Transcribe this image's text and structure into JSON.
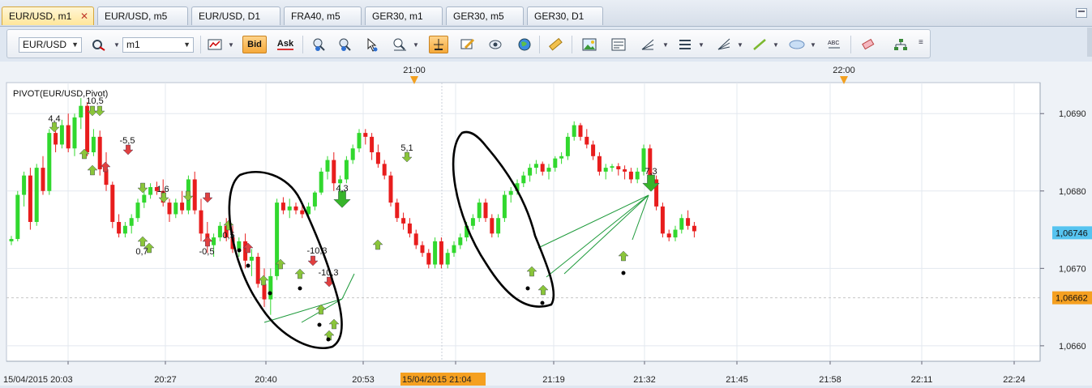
{
  "tabs": [
    {
      "label": "EUR/USD, m1",
      "active": true
    },
    {
      "label": "EUR/USD, m5",
      "active": false
    },
    {
      "label": "EUR/USD, D1",
      "active": false
    },
    {
      "label": "FRA40, m5",
      "active": false
    },
    {
      "label": "GER30, m1",
      "active": false
    },
    {
      "label": "GER30, m5",
      "active": false
    },
    {
      "label": "GER30, D1",
      "active": false
    }
  ],
  "toolbar": {
    "symbol": "EUR/USD",
    "timeframe": "m1",
    "bid_label": "Bid",
    "ask_label": "Ask",
    "icons": [
      "symbol-dropdown",
      "remove-symbol-icon",
      "timeframe-dropdown",
      "chart-type-icon",
      "bid-button",
      "ask-button",
      "zoom-in-icon",
      "zoom-out-icon",
      "cursor-icon",
      "zoom-tool-icon",
      "crosshair-icon",
      "edit-icon",
      "eye-icon",
      "globe-icon",
      "ruler-icon",
      "image-icon",
      "template-icon",
      "fork-icon",
      "lines-icon",
      "fan-icon",
      "trendline-icon",
      "ellipse-icon",
      "text-icon",
      "eraser-icon",
      "hierarchy-icon"
    ]
  },
  "chart_data": {
    "type": "candlestick",
    "indicator_label": "PIVOT(EUR/USD,Pivot)",
    "top_time_markers": [
      "21:00",
      "22:00"
    ],
    "x_tick_labels": [
      "15/04/2015 20:03",
      "20:27",
      "20:40",
      "20:53",
      "15/04/2015 21:04",
      "21:19",
      "21:32",
      "21:45",
      "21:58",
      "22:11",
      "22:24"
    ],
    "y_tick_labels": [
      "1,0690",
      "1,0680",
      "1,0670",
      "1,0660"
    ],
    "ylim": [
      1.0658,
      1.0694
    ],
    "current_price_label": "1,06746",
    "level_price_label": "1,06662",
    "annotations": [
      {
        "text": "4,4"
      },
      {
        "text": "10,5"
      },
      {
        "text": "-5,5"
      },
      {
        "text": "1,6"
      },
      {
        "text": "0,7"
      },
      {
        "text": "-0,5"
      },
      {
        "text": "0,5"
      },
      {
        "text": "4,3"
      },
      {
        "text": "-10,3"
      },
      {
        "text": "-10,3"
      },
      {
        "text": "5,1"
      },
      {
        "text": "7,3"
      }
    ],
    "candles": [
      [
        1.06735,
        1.06742,
        1.0673,
        1.06738
      ],
      [
        1.06738,
        1.068,
        1.06735,
        1.06795
      ],
      [
        1.06795,
        1.06825,
        1.0678,
        1.0682
      ],
      [
        1.0682,
        1.0683,
        1.0675,
        1.0676
      ],
      [
        1.0676,
        1.06835,
        1.06755,
        1.0683
      ],
      [
        1.0683,
        1.06845,
        1.06795,
        1.068
      ],
      [
        1.068,
        1.0688,
        1.06795,
        1.06875
      ],
      [
        1.06875,
        1.06885,
        1.0685,
        1.0686
      ],
      [
        1.0686,
        1.06892,
        1.06855,
        1.06885
      ],
      [
        1.06885,
        1.069,
        1.0685,
        1.06855
      ],
      [
        1.06855,
        1.069,
        1.06845,
        1.06895
      ],
      [
        1.06895,
        1.0692,
        1.0688,
        1.0691
      ],
      [
        1.0691,
        1.06915,
        1.06845,
        1.0685
      ],
      [
        1.0685,
        1.0688,
        1.06845,
        1.0687
      ],
      [
        1.0687,
        1.06878,
        1.0682,
        1.06828
      ],
      [
        1.06828,
        1.0685,
        1.068,
        1.06808
      ],
      [
        1.06808,
        1.06812,
        1.06752,
        1.0676
      ],
      [
        1.0676,
        1.0677,
        1.0674,
        1.06745
      ],
      [
        1.06745,
        1.0676,
        1.0674,
        1.06755
      ],
      [
        1.06755,
        1.0677,
        1.06745,
        1.06765
      ],
      [
        1.06765,
        1.0679,
        1.0676,
        1.06785
      ],
      [
        1.06785,
        1.068,
        1.06778,
        1.06795
      ],
      [
        1.06795,
        1.0681,
        1.0679,
        1.06805
      ],
      [
        1.06805,
        1.06812,
        1.06795,
        1.068
      ],
      [
        1.068,
        1.06815,
        1.0678,
        1.06785
      ],
      [
        1.06785,
        1.0679,
        1.0676,
        1.0677
      ],
      [
        1.0677,
        1.0679,
        1.06765,
        1.06785
      ],
      [
        1.06785,
        1.068,
        1.0677,
        1.06775
      ],
      [
        1.06775,
        1.0682,
        1.0677,
        1.06815
      ],
      [
        1.06815,
        1.06825,
        1.0677,
        1.06775
      ],
      [
        1.06775,
        1.0679,
        1.06735,
        1.06745
      ],
      [
        1.06745,
        1.0676,
        1.0672,
        1.0673
      ],
      [
        1.0673,
        1.06745,
        1.06715,
        1.0674
      ],
      [
        1.0674,
        1.0676,
        1.06735,
        1.06755
      ],
      [
        1.06755,
        1.06765,
        1.06735,
        1.0674
      ],
      [
        1.0674,
        1.06755,
        1.0672,
        1.06725
      ],
      [
        1.06725,
        1.0674,
        1.06715,
        1.06735
      ],
      [
        1.06735,
        1.06745,
        1.067,
        1.0671
      ],
      [
        1.0671,
        1.06725,
        1.0669,
        1.06715
      ],
      [
        1.06715,
        1.0672,
        1.06675,
        1.0668
      ],
      [
        1.0668,
        1.067,
        1.0665,
        1.0666
      ],
      [
        1.0666,
        1.067,
        1.0664,
        1.0669
      ],
      [
        1.0669,
        1.0679,
        1.06685,
        1.06785
      ],
      [
        1.06785,
        1.06792,
        1.0677,
        1.06775
      ],
      [
        1.06775,
        1.0679,
        1.06765,
        1.0678
      ],
      [
        1.0678,
        1.06785,
        1.0677,
        1.06775
      ],
      [
        1.06775,
        1.06785,
        1.06765,
        1.0677
      ],
      [
        1.0677,
        1.06785,
        1.06765,
        1.0678
      ],
      [
        1.0678,
        1.068,
        1.06775,
        1.06798
      ],
      [
        1.06798,
        1.0683,
        1.06795,
        1.06825
      ],
      [
        1.06825,
        1.06845,
        1.06815,
        1.0684
      ],
      [
        1.0684,
        1.0685,
        1.068,
        1.0681
      ],
      [
        1.0681,
        1.0682,
        1.06795,
        1.06815
      ],
      [
        1.06815,
        1.06845,
        1.0681,
        1.0684
      ],
      [
        1.0684,
        1.0686,
        1.06835,
        1.06855
      ],
      [
        1.06855,
        1.0688,
        1.0685,
        1.06875
      ],
      [
        1.06875,
        1.0688,
        1.0686,
        1.0687
      ],
      [
        1.0687,
        1.06875,
        1.0684,
        1.0685
      ],
      [
        1.0685,
        1.0686,
        1.0683,
        1.06835
      ],
      [
        1.06835,
        1.0684,
        1.06815,
        1.0682
      ],
      [
        1.0682,
        1.06825,
        1.0678,
        1.06785
      ],
      [
        1.06785,
        1.0679,
        1.0676,
        1.06765
      ],
      [
        1.06765,
        1.06772,
        1.0675,
        1.06758
      ],
      [
        1.06758,
        1.06765,
        1.0674,
        1.06745
      ],
      [
        1.06745,
        1.0675,
        1.06725,
        1.0673
      ],
      [
        1.0673,
        1.06735,
        1.06715,
        1.0672
      ],
      [
        1.0672,
        1.06725,
        1.067,
        1.06705
      ],
      [
        1.06705,
        1.0674,
        1.067,
        1.06735
      ],
      [
        1.06735,
        1.0674,
        1.067,
        1.06705
      ],
      [
        1.06705,
        1.06725,
        1.067,
        1.0672
      ],
      [
        1.0672,
        1.06735,
        1.06715,
        1.0673
      ],
      [
        1.0673,
        1.06745,
        1.06725,
        1.0674
      ],
      [
        1.0674,
        1.0676,
        1.06735,
        1.06755
      ],
      [
        1.06755,
        1.0677,
        1.0675,
        1.06765
      ],
      [
        1.06765,
        1.0679,
        1.0676,
        1.06785
      ],
      [
        1.06785,
        1.0679,
        1.0676,
        1.06765
      ],
      [
        1.06765,
        1.0677,
        1.0674,
        1.06745
      ],
      [
        1.06745,
        1.0677,
        1.0674,
        1.06765
      ],
      [
        1.06765,
        1.068,
        1.0676,
        1.06795
      ],
      [
        1.06795,
        1.06805,
        1.06785,
        1.068
      ],
      [
        1.068,
        1.06815,
        1.06795,
        1.0681
      ],
      [
        1.0681,
        1.06825,
        1.06805,
        1.0682
      ],
      [
        1.0682,
        1.06835,
        1.06812,
        1.0683
      ],
      [
        1.0683,
        1.0684,
        1.06822,
        1.06835
      ],
      [
        1.06835,
        1.06838,
        1.0682,
        1.06825
      ],
      [
        1.06825,
        1.06835,
        1.06815,
        1.0683
      ],
      [
        1.0683,
        1.06845,
        1.06825,
        1.06842
      ],
      [
        1.06842,
        1.0685,
        1.06835,
        1.06845
      ],
      [
        1.06845,
        1.06875,
        1.0684,
        1.0687
      ],
      [
        1.0687,
        1.0689,
        1.06865,
        1.06885
      ],
      [
        1.06885,
        1.06888,
        1.06865,
        1.0687
      ],
      [
        1.0687,
        1.0688,
        1.06855,
        1.0686
      ],
      [
        1.0686,
        1.06865,
        1.0684,
        1.06845
      ],
      [
        1.06845,
        1.0685,
        1.0682,
        1.06825
      ],
      [
        1.06825,
        1.06835,
        1.06815,
        1.0683
      ],
      [
        1.0683,
        1.06835,
        1.06825,
        1.06832
      ],
      [
        1.06832,
        1.06836,
        1.0682,
        1.06828
      ],
      [
        1.06828,
        1.06833,
        1.06815,
        1.06825
      ],
      [
        1.06825,
        1.0683,
        1.0681,
        1.06815
      ],
      [
        1.06815,
        1.0683,
        1.0681,
        1.06825
      ],
      [
        1.06825,
        1.0686,
        1.0682,
        1.06855
      ],
      [
        1.06855,
        1.0686,
        1.0681,
        1.06815
      ],
      [
        1.06815,
        1.0682,
        1.06775,
        1.0678
      ],
      [
        1.0678,
        1.06785,
        1.0674,
        1.06745
      ],
      [
        1.06745,
        1.0675,
        1.06735,
        1.0674
      ],
      [
        1.0674,
        1.06755,
        1.06735,
        1.0675
      ],
      [
        1.0675,
        1.0677,
        1.06745,
        1.06765
      ],
      [
        1.06765,
        1.06775,
        1.0675,
        1.06755
      ],
      [
        1.06755,
        1.0676,
        1.0674,
        1.06748
      ]
    ]
  }
}
